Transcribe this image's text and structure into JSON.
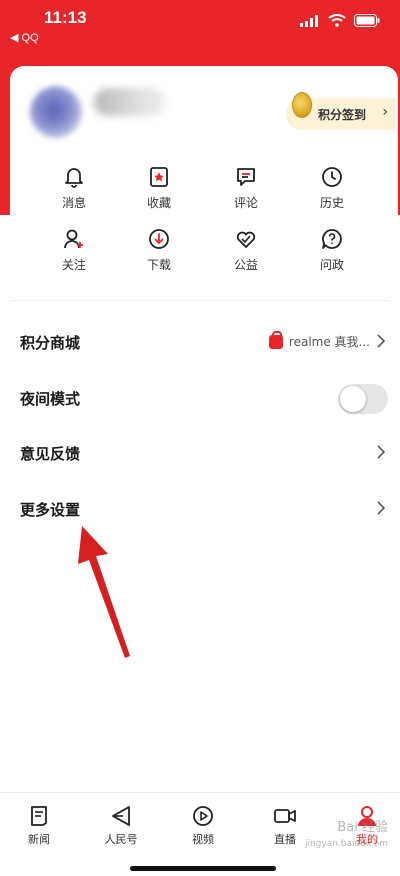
{
  "status_bar": {
    "time": "11:13",
    "back_app": "◀ QQ"
  },
  "profile": {
    "checkin_label": "积分签到"
  },
  "quick_actions": [
    {
      "label": "消息",
      "icon": "bell-icon"
    },
    {
      "label": "收藏",
      "icon": "star-bookmark-icon"
    },
    {
      "label": "评论",
      "icon": "comment-icon"
    },
    {
      "label": "历史",
      "icon": "clock-icon"
    },
    {
      "label": "关注",
      "icon": "add-person-icon"
    },
    {
      "label": "下载",
      "icon": "download-icon"
    },
    {
      "label": "公益",
      "icon": "heart-icon"
    },
    {
      "label": "问政",
      "icon": "question-icon"
    }
  ],
  "menu": {
    "points_mall": {
      "label": "积分商城",
      "extra": "realme 真我..."
    },
    "night_mode": {
      "label": "夜间模式",
      "enabled": false
    },
    "feedback": {
      "label": "意见反馈"
    },
    "more_settings": {
      "label": "更多设置"
    }
  },
  "tab_bar": [
    {
      "label": "新闻",
      "icon": "news-icon",
      "active": false
    },
    {
      "label": "人民号",
      "icon": "paper-plane-icon",
      "active": false
    },
    {
      "label": "视频",
      "icon": "play-icon",
      "active": false
    },
    {
      "label": "直播",
      "icon": "video-camera-icon",
      "active": false
    },
    {
      "label": "我的",
      "icon": "person-icon",
      "active": true
    }
  ],
  "watermark": {
    "line1": "Bai 经验",
    "line2": "jingyan.baidu.com"
  },
  "colors": {
    "brand_red": "#e8262a",
    "checkin_bg": "#fdf1d6",
    "toggle_off": "#e6e6e6"
  }
}
